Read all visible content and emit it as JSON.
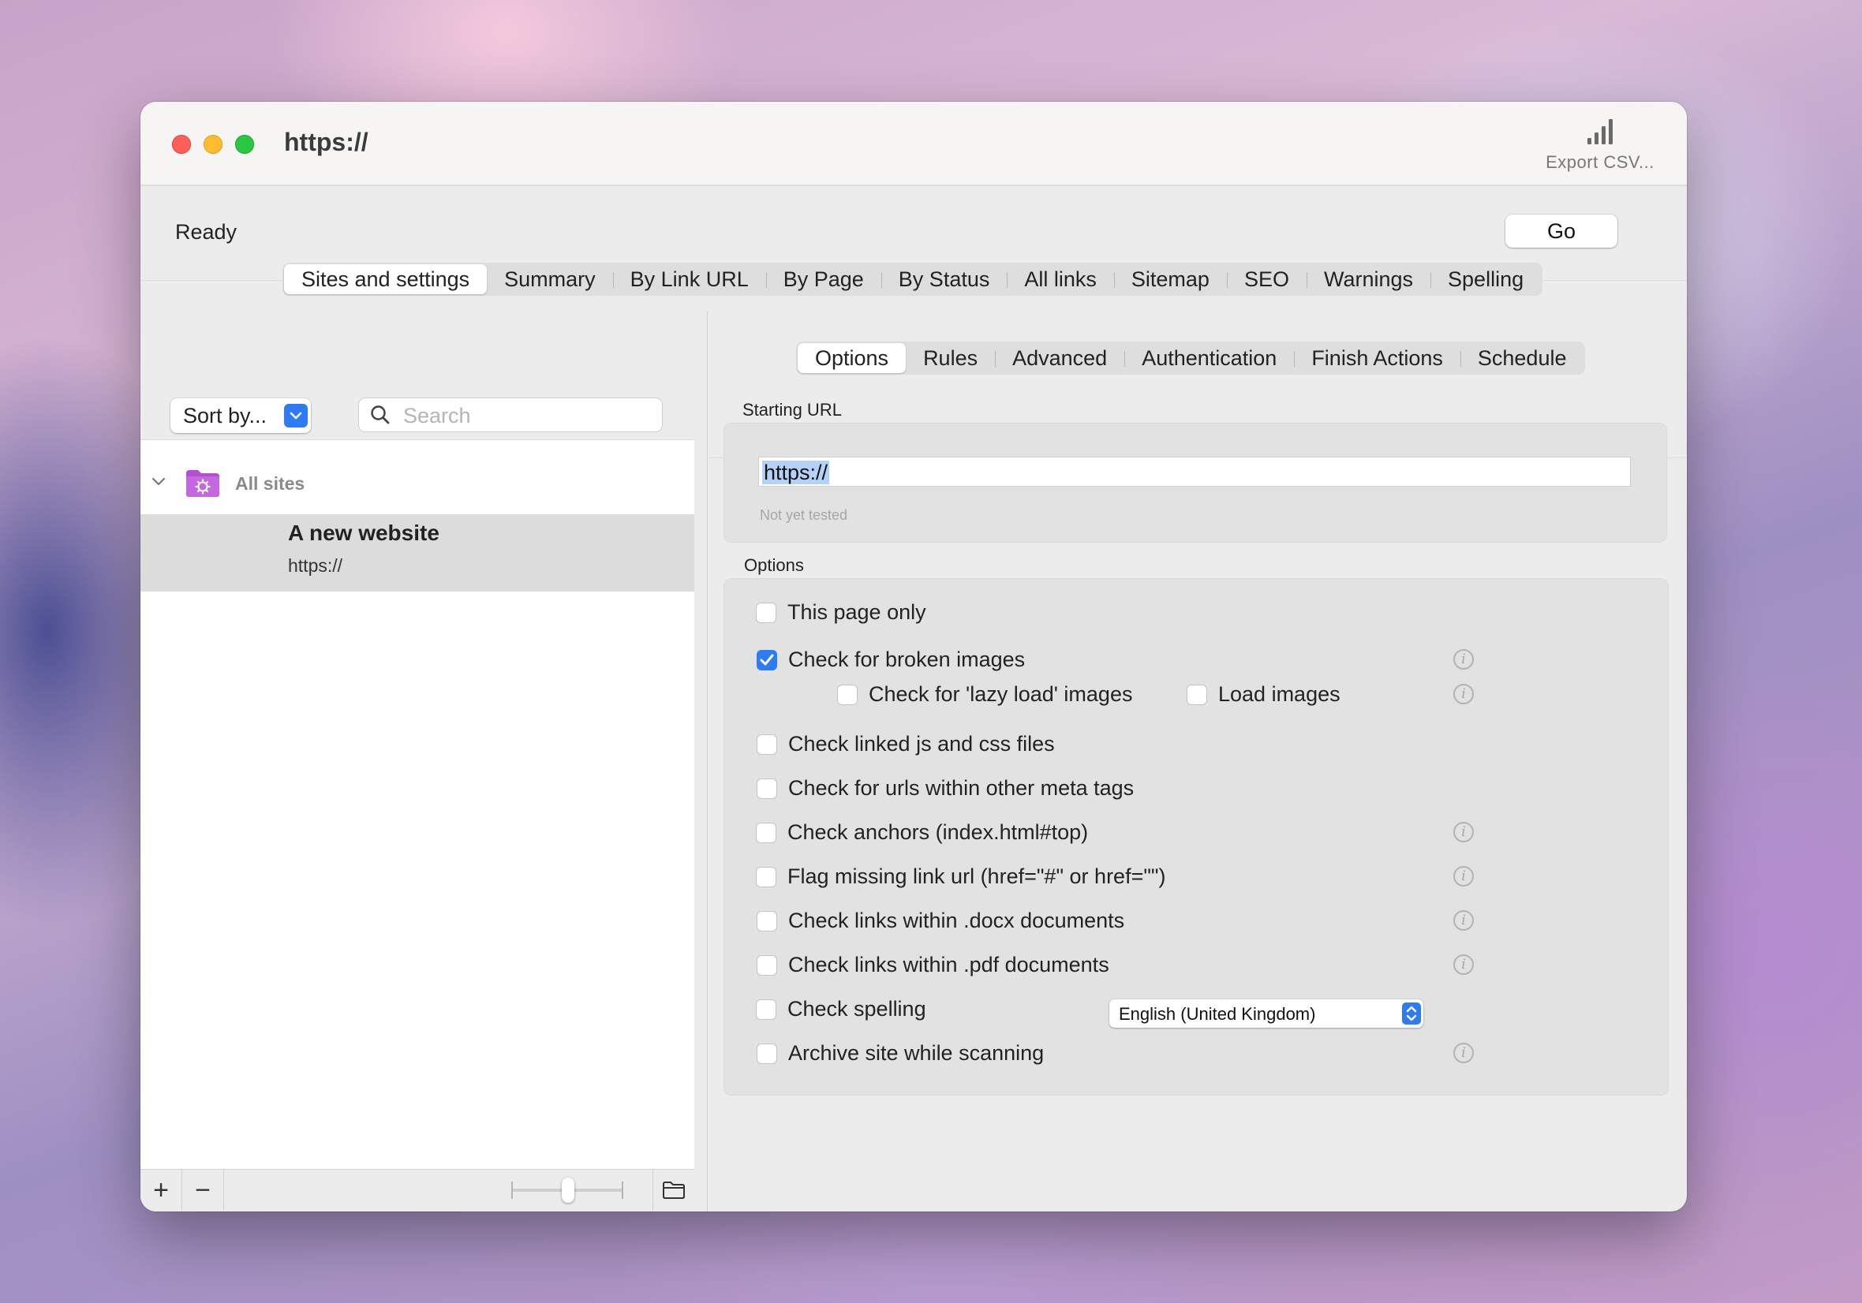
{
  "window": {
    "title": "https://",
    "export_label": "Export CSV...",
    "export_icon": "signal-bars-icon"
  },
  "toolbar": {
    "status": "Ready",
    "go_label": "Go"
  },
  "main_tabs": [
    {
      "label": "Sites and settings",
      "active": true
    },
    {
      "label": "Summary"
    },
    {
      "label": "By Link URL"
    },
    {
      "label": "By Page"
    },
    {
      "label": "By Status"
    },
    {
      "label": "All links"
    },
    {
      "label": "Sitemap"
    },
    {
      "label": "SEO"
    },
    {
      "label": "Warnings"
    },
    {
      "label": "Spelling"
    }
  ],
  "sidebar": {
    "sort_label": "Sort by...",
    "search_placeholder": "Search",
    "group_label": "All sites",
    "sites": [
      {
        "name": "A new website",
        "url": "https://"
      }
    ],
    "add_label": "+",
    "remove_label": "−"
  },
  "sub_tabs": [
    {
      "label": "Options",
      "active": true
    },
    {
      "label": "Rules"
    },
    {
      "label": "Advanced"
    },
    {
      "label": "Authentication"
    },
    {
      "label": "Finish Actions"
    },
    {
      "label": "Schedule"
    }
  ],
  "starting_url": {
    "label": "Starting URL",
    "value": "https://",
    "hint": "Not yet tested"
  },
  "options": {
    "label": "Options",
    "items": [
      {
        "label": "This page only",
        "checked": false
      },
      {
        "label": "Check for broken images",
        "checked": true
      },
      {
        "label": "Check for 'lazy load' images",
        "checked": false
      },
      {
        "label": "Load images",
        "checked": false
      },
      {
        "label": "Check linked js and css files",
        "checked": false
      },
      {
        "label": "Check for urls within other meta tags",
        "checked": false
      },
      {
        "label": "Check anchors (index.html#top)",
        "checked": false
      },
      {
        "label": "Flag missing link url (href=\"#\" or href=\"\")",
        "checked": false
      },
      {
        "label": "Check links within .docx documents",
        "checked": false
      },
      {
        "label": "Check links within .pdf documents",
        "checked": false
      },
      {
        "label": "Check spelling",
        "checked": false
      },
      {
        "label": "Archive site while scanning",
        "checked": false
      }
    ],
    "spelling_language": "English (United Kingdom)",
    "info_glyph": "i"
  },
  "colors": {
    "accent": "#2d7cf6",
    "close": "#fe5f57",
    "minimize": "#febc2e",
    "zoom": "#28c840",
    "folder": "#b44fd3"
  }
}
